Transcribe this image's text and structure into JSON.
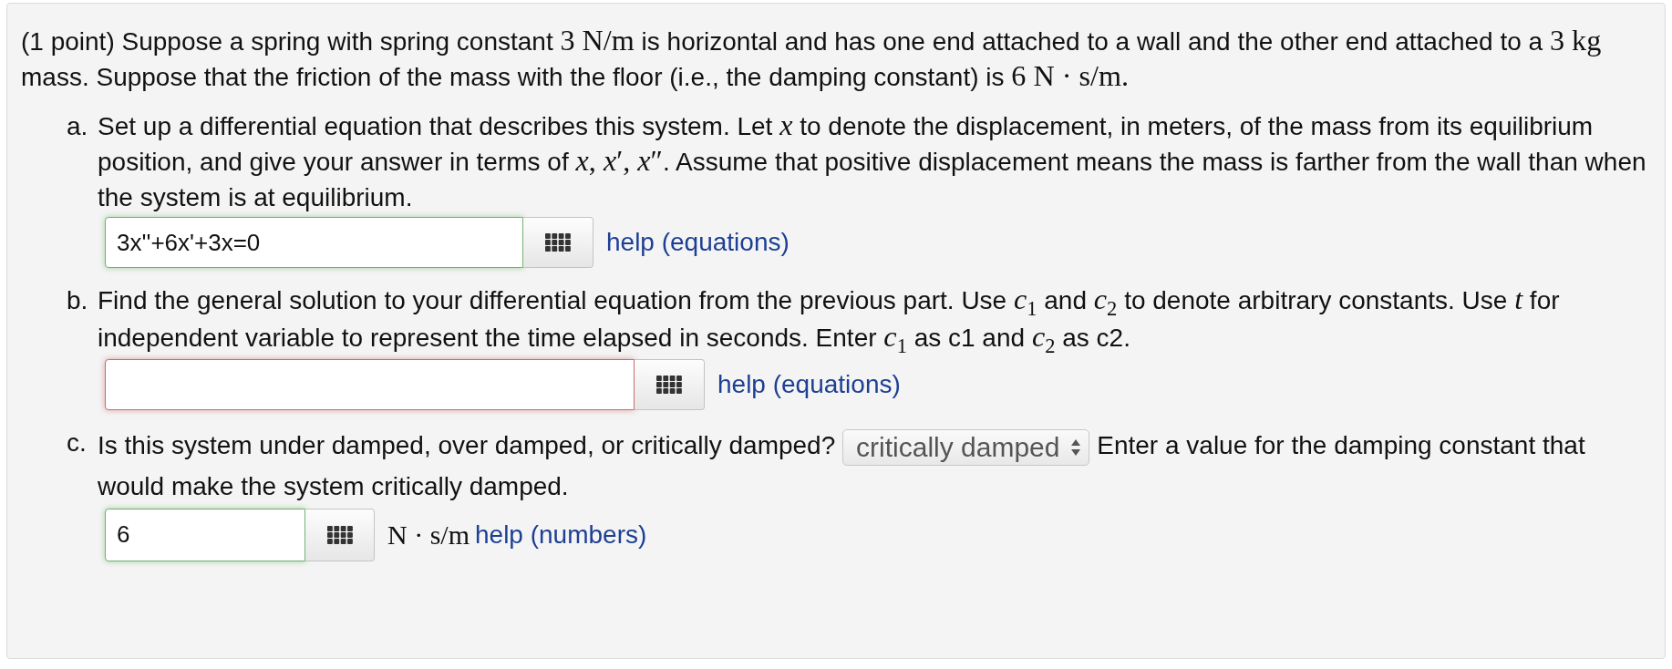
{
  "problem": {
    "intro": [
      {
        "kind": "text",
        "s": "(1 point) Suppose a spring with spring constant "
      },
      {
        "kind": "math",
        "s": "3 N/m"
      },
      {
        "kind": "text",
        "s": " is horizontal and has one end attached to a wall and the other end attached to a "
      },
      {
        "kind": "math",
        "s": "3 kg"
      },
      {
        "kind": "text",
        "s": " mass. Suppose that the friction of the mass with the floor (i.e., the damping constant) is "
      },
      {
        "kind": "math",
        "s": "6 N · s/m."
      }
    ],
    "parts": [
      {
        "marker": "a.",
        "prompt": [
          {
            "kind": "text",
            "runs": [
              {
                "kind": "text",
                "s": "Set up a differential equation that describes this system. Let "
              },
              {
                "kind": "math",
                "s": "*x*"
              },
              {
                "kind": "text",
                "s": " to denote the displacement, in meters, of the mass from its equilibrium position, and give your answer in terms of "
              },
              {
                "kind": "math",
                "s": "*x*, *x*′, *x*″"
              },
              {
                "kind": "text",
                "s": ". Assume that positive displacement means the mass is farther from the wall than when the system is at equilibrium."
              }
            ]
          }
        ],
        "answer": {
          "value": "3x''+6x'+3x=0",
          "correct": true
        },
        "help": "help (equations)"
      },
      {
        "marker": "b.",
        "prompt": [
          {
            "kind": "text",
            "runs": [
              {
                "kind": "text",
                "s": "Find the general solution to your differential equation from the previous part. Use "
              },
              {
                "kind": "math",
                "s": "*c*$_{1}$"
              },
              {
                "kind": "text",
                "s": " and "
              },
              {
                "kind": "math",
                "s": "*c*$_{2}$"
              },
              {
                "kind": "text",
                "s": " to denote arbitrary constants. Use "
              },
              {
                "kind": "math",
                "s": "*t*"
              },
              {
                "kind": "text",
                "s": " for independent variable to represent the time elapsed in seconds. Enter "
              },
              {
                "kind": "math",
                "s": "*c*$_{1}$"
              },
              {
                "kind": "text",
                "s": " as c1 and "
              },
              {
                "kind": "math",
                "s": "*c*$_{2}$"
              },
              {
                "kind": "text",
                "s": " as c2."
              }
            ]
          }
        ],
        "answer": {
          "correct": false
        },
        "help": "help (equations)"
      },
      {
        "marker": "c.",
        "prompt": [
          {
            "kind": "text",
            "runs": [
              {
                "kind": "text",
                "s": "Is this system under damped, over damped, or critically damped?"
              }
            ]
          },
          {
            "kind": "select",
            "value": "critically damped"
          },
          {
            "kind": "text",
            "runs": [
              {
                "kind": "text",
                "s": "Enter a value for the damping constant that"
              }
            ]
          },
          {
            "kind": "text",
            "runs": [
              {
                "kind": "text",
                "s": "would make the system critically damped."
              }
            ]
          }
        ],
        "answer": {
          "value": "6",
          "correct": true
        },
        "unit": "N · s/m",
        "help": "help (numbers)"
      }
    ]
  }
}
